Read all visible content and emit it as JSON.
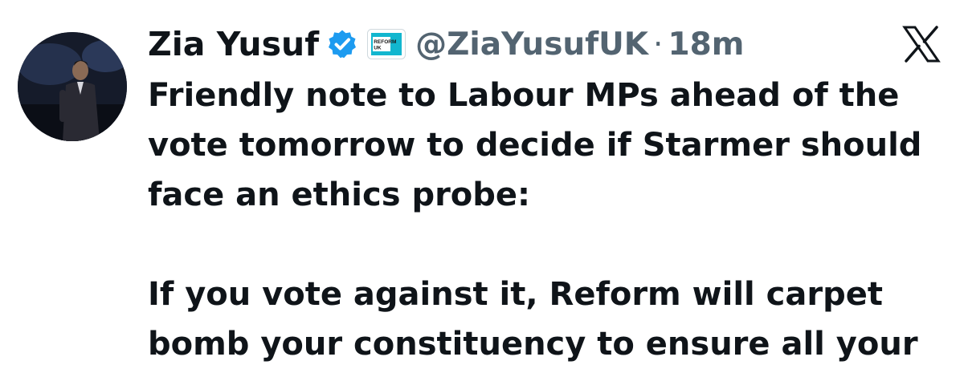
{
  "tweet": {
    "display_name": "Zia Yusuf",
    "handle": "@ZiaYusufUK",
    "separator": "·",
    "time": "18m",
    "affiliate_badge_text": [
      "REFORM",
      "UK"
    ],
    "paragraphs": [
      "Friendly note to Labour MPs ahead of the\nvote tomorrow to decide if Starmer should\nface an ethics probe:",
      "If you vote against it, Reform will carpet\nbomb your constituency to ensure all your"
    ]
  },
  "icons": {
    "verified": "verified-badge-icon",
    "affiliate": "reform-uk-logo-icon",
    "platform": "x-logo-icon"
  },
  "colors": {
    "verified_blue": "#1d9bf0",
    "reform_teal": "#12b6cf",
    "text": "#0f1419",
    "muted": "#536471"
  }
}
